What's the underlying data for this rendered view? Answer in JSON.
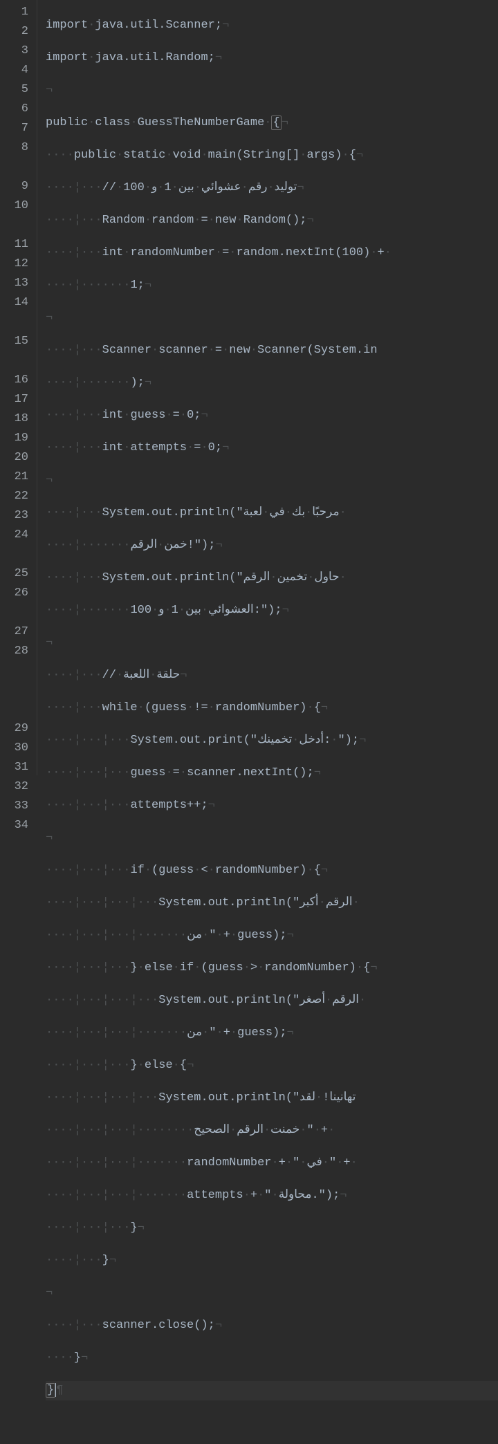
{
  "editor": {
    "language": "java",
    "showWhitespace": true,
    "lineNumbers": [
      "1",
      "2",
      "3",
      "4",
      "5",
      "6",
      "7",
      "8",
      "9",
      "10",
      "11",
      "12",
      "13",
      "14",
      "15",
      "16",
      "17",
      "18",
      "19",
      "20",
      "21",
      "22",
      "23",
      "24",
      "25",
      "26",
      "27",
      "28",
      "29",
      "30",
      "31",
      "32",
      "33",
      "34"
    ],
    "lines": {
      "l1": "import java.util.Scanner;",
      "l2": "import java.util.Random;",
      "l3": "",
      "l4": "public class GuessTheNumberGame {",
      "l5": "    public static void main(String[] args) {",
      "l6": "        // توليد رقم عشوائي بين 1 و 100",
      "l7": "        Random random = new Random();",
      "l8a": "        int randomNumber = random.nextInt(100) + ",
      "l8b": "            1;",
      "l9": "",
      "l10a": "        Scanner scanner = new Scanner(System.in",
      "l10b": "            );",
      "l11": "        int guess = 0;",
      "l12": "        int attempts = 0;",
      "l13": "",
      "l14a": "        System.out.println(\"مرحبًا بك في لعبة ",
      "l14b": "            خمن الرقم!\");",
      "l15a": "        System.out.println(\"حاول تخمين الرقم ",
      "l15b": "            العشوائي بين 1 و 100:\");",
      "l16": "",
      "l17": "        // حلقة اللعبة",
      "l18": "        while (guess != randomNumber) {",
      "l19": "            System.out.print(\"أدخل تخمينك: \");",
      "l20": "            guess = scanner.nextInt();",
      "l21": "            attempts++;",
      "l22": "",
      "l23": "            if (guess < randomNumber) {",
      "l24a": "                System.out.println(\"الرقم أكبر ",
      "l24b": "                    من \" + guess);",
      "l25": "            } else if (guess > randomNumber) {",
      "l26a": "                System.out.println(\"الرقم أصغر ",
      "l26b": "                    من \" + guess);",
      "l27": "            } else {",
      "l28a": "                System.out.println(\"تهانينا! لقد",
      "l28b": "                     خمنت الرقم الصحيح \" + ",
      "l28c": "                    randomNumber + \" في \" + ",
      "l28d": "                    attempts + \" محاولة.\");",
      "l29": "            }",
      "l30": "        }",
      "l31": "",
      "l32": "        scanner.close();",
      "l33": "    }",
      "l34": "}"
    }
  }
}
